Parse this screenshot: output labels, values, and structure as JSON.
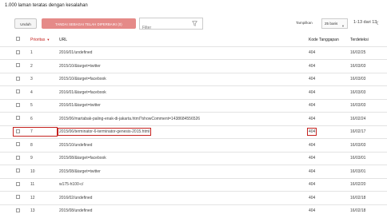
{
  "summary": "1.000 laman teratas dengan kesalahan",
  "toolbar": {
    "download_label": "Unduh",
    "mark_fixed_label": "TANDAI SEBAGAI TELAH DIPERBAIKI (0)",
    "filter_placeholder": "Filter",
    "rows_label": "Tampilkan",
    "rows_value": "25 baris",
    "range": "1-13 dari 13",
    "prev": "‹",
    "next": "›"
  },
  "table": {
    "headers": {
      "priority": "Prioritas",
      "url": "URL",
      "code": "Kode Tanggapan",
      "detected": "Terdeteksi"
    },
    "rows": [
      {
        "priority": "1",
        "url": "2016/01/undefined",
        "code": "404",
        "detected": "16/02/25"
      },
      {
        "priority": "2",
        "url": "2015/10/&target=twitter",
        "code": "404",
        "detected": "16/03/03"
      },
      {
        "priority": "3",
        "url": "2015/10/&target=facebook",
        "code": "404",
        "detected": "16/03/03"
      },
      {
        "priority": "4",
        "url": "2016/01/&target=facebook",
        "code": "404",
        "detected": "16/03/03"
      },
      {
        "priority": "5",
        "url": "2016/01/&target=twitter",
        "code": "404",
        "detected": "16/03/03"
      },
      {
        "priority": "6",
        "url": "2015/06/martabak-paling-enak-di-jakarta.html?showComment=1438684556526",
        "code": "404",
        "detected": "16/02/24"
      },
      {
        "priority": "7",
        "url": "2015/06/terminator-6-terminator-genesis-2015.html",
        "code": "404",
        "detected": "16/02/17"
      },
      {
        "priority": "8",
        "url": "2015/10/undefined",
        "code": "404",
        "detected": "16/03/03"
      },
      {
        "priority": "9",
        "url": "2015/08/&target=facebook",
        "code": "404",
        "detected": "16/03/01"
      },
      {
        "priority": "10",
        "url": "2015/08/&target=twitter",
        "code": "404",
        "detected": "16/03/01"
      },
      {
        "priority": "11",
        "url": "w175-h100-c/",
        "code": "404",
        "detected": "16/02/20"
      },
      {
        "priority": "12",
        "url": "2016/02/undefined",
        "code": "404",
        "detected": "16/02/18"
      },
      {
        "priority": "13",
        "url": "2015/08/undefined",
        "code": "404",
        "detected": "16/02/18"
      }
    ]
  },
  "colors": {
    "highlight": "#c5221f",
    "mark_fixed_button": "#e58a88"
  }
}
